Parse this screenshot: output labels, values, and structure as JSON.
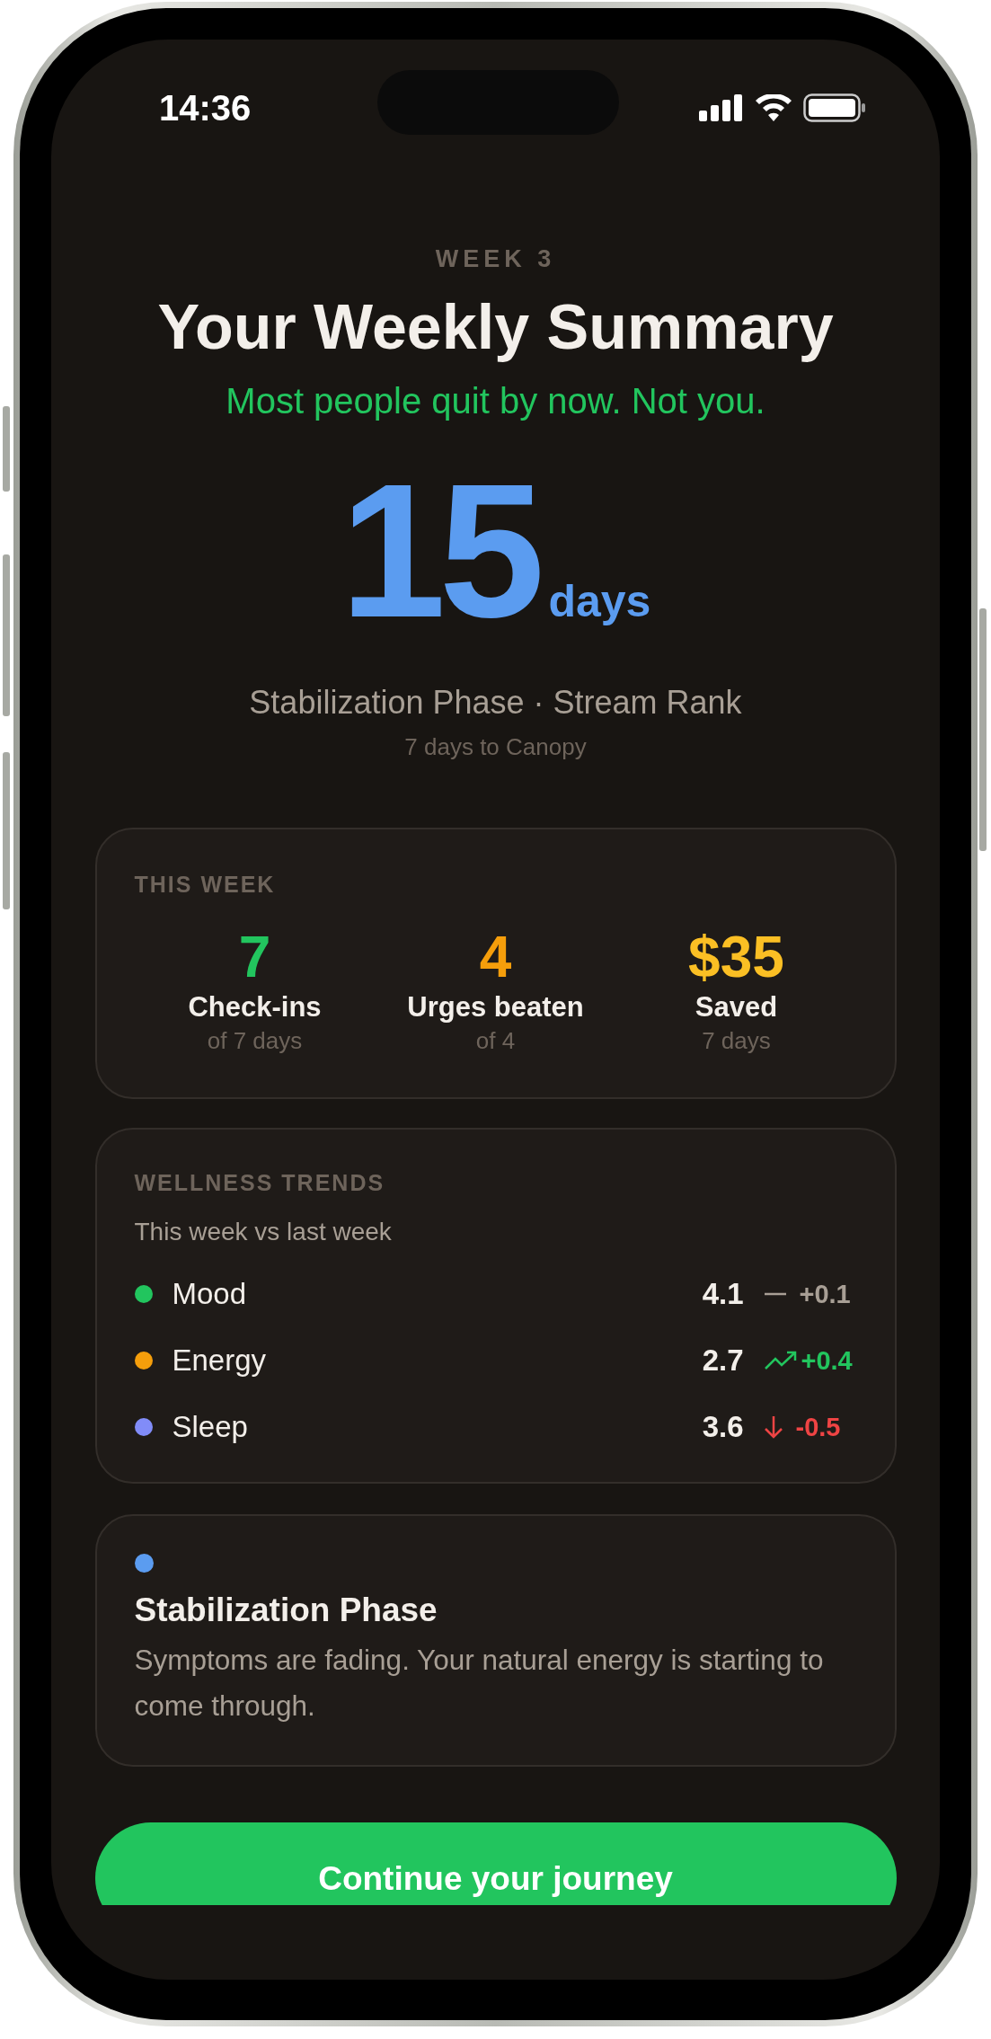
{
  "status_bar": {
    "time": "14:36"
  },
  "header": {
    "eyebrow": "WEEK 3",
    "title": "Your Weekly Summary",
    "tagline": "Most people quit by now. Not you."
  },
  "streak": {
    "count": "15",
    "unit": "days",
    "phase_line": "Stabilization Phase · Stream Rank",
    "next_rank": "7 days to Canopy"
  },
  "this_week": {
    "heading": "THIS WEEK",
    "stats": [
      {
        "value": "7",
        "label": "Check-ins",
        "detail": "of 7 days",
        "color": "#22c55e"
      },
      {
        "value": "4",
        "label": "Urges beaten",
        "detail": "of 4",
        "color": "#f59e0b"
      },
      {
        "value": "$35",
        "label": "Saved",
        "detail": "7 days",
        "color": "#fbbf24"
      }
    ]
  },
  "wellness_trends": {
    "heading": "WELLNESS TRENDS",
    "subtitle": "This week vs last week",
    "rows": [
      {
        "name": "Mood",
        "color": "#22c55e",
        "score": "4.1",
        "kind": "flat",
        "change": "+0.1"
      },
      {
        "name": "Energy",
        "color": "#f59e0b",
        "score": "2.7",
        "kind": "up",
        "change": "+0.4"
      },
      {
        "name": "Sleep",
        "color": "#818cf8",
        "score": "3.6",
        "kind": "down",
        "change": "-0.5"
      }
    ]
  },
  "phase_card": {
    "title": "Stabilization Phase",
    "body": "Symptoms are fading. Your natural energy is starting to come through."
  },
  "primary_button": {
    "label": "Continue your journey"
  }
}
